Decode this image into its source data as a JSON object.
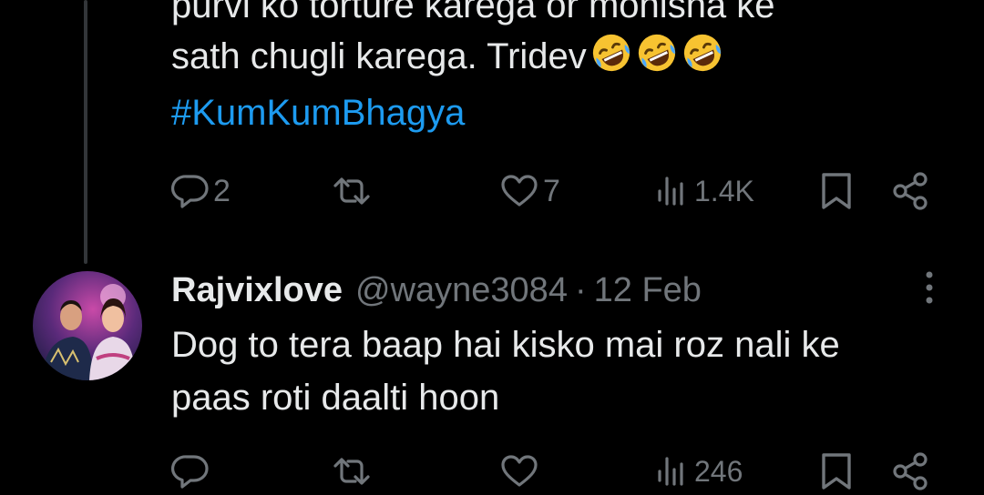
{
  "tweet1": {
    "text_lines": [
      "purvi ko torture karega or monisha ke",
      "sath chugli karega. Tridev"
    ],
    "emojis": [
      "rolling-on-floor-laughing",
      "rolling-on-floor-laughing",
      "rolling-on-floor-laughing"
    ],
    "hashtag": "#KumKumBhagya",
    "actions": {
      "replies": "2",
      "retweets": "",
      "likes": "7",
      "views": "1.4K"
    }
  },
  "tweet2": {
    "display_name": "Rajvixlove",
    "handle": "@wayne3084",
    "separator": "·",
    "date": "12 Feb",
    "text_lines": [
      "Dog to tera baap hai kisko mai roz nali ke",
      "paas roti daalti hoon"
    ],
    "actions": {
      "replies": "",
      "retweets": "",
      "likes": "",
      "views": "246"
    }
  },
  "colors": {
    "background": "#000000",
    "text": "#e7e9ea",
    "muted": "#71767b",
    "hashtag": "#1d9bf0",
    "thread_line": "#333639"
  }
}
